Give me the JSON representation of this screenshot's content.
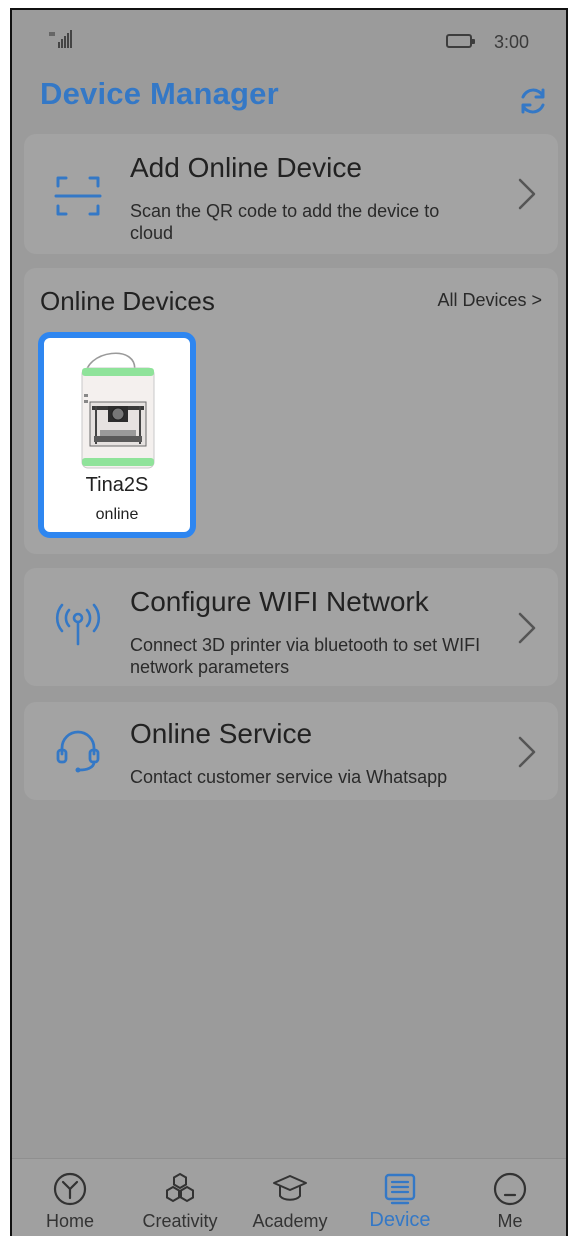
{
  "status_bar": {
    "signal_icon": "signal-icon",
    "battery_icon": "battery-icon",
    "time": "3:00"
  },
  "header": {
    "title": "Device Manager",
    "refresh_icon": "refresh-icon"
  },
  "add_device": {
    "icon": "scan-icon",
    "title": "Add Online Device",
    "description": "Scan the QR code to add the device to cloud"
  },
  "online_devices": {
    "title": "Online Devices",
    "all_devices_link": "All Devices >",
    "devices": [
      {
        "name": "Tina2S",
        "status": "online",
        "icon": "printer-image"
      }
    ]
  },
  "configure_wifi": {
    "icon": "wifi-antenna-icon",
    "title": "Configure WIFI Network",
    "description": "Connect 3D printer via bluetooth to set WIFI network parameters"
  },
  "online_service": {
    "icon": "headset-icon",
    "title": "Online Service",
    "description": "Contact customer service via Whatsapp"
  },
  "tab_bar": {
    "tabs": [
      {
        "label": "Home",
        "icon": "home-icon"
      },
      {
        "label": "Creativity",
        "icon": "creativity-icon"
      },
      {
        "label": "Academy",
        "icon": "academy-icon"
      },
      {
        "label": "Device",
        "icon": "device-icon",
        "active": true
      },
      {
        "label": "Me",
        "icon": "me-icon"
      }
    ]
  },
  "colors": {
    "accent": "#3478c6",
    "selected_border": "#2e86f0",
    "background": "#9b9b9b",
    "card": "#a3a3a3"
  }
}
